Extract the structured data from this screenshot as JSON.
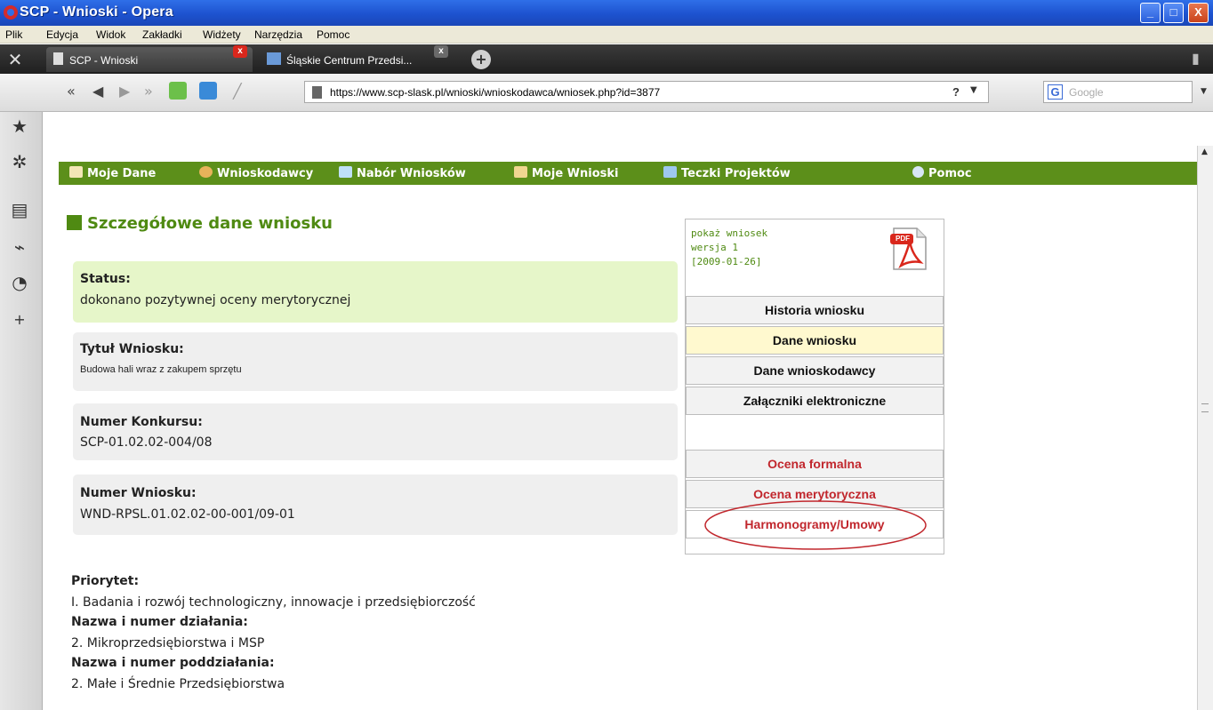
{
  "window": {
    "title": "SCP - Wnioski - Opera",
    "controls": [
      "_",
      "□",
      "X"
    ]
  },
  "menu": [
    "Plik",
    "Edycja",
    "Widok",
    "Zakładki",
    "Widżety",
    "Narzędzia",
    "Pomoc"
  ],
  "tabs": [
    {
      "label": "SCP - Wnioski",
      "active": true
    },
    {
      "label": "Śląskie Centrum Przedsi..."
    }
  ],
  "address": {
    "url": "https://www.scp-slask.pl/wnioski/wnioskodawca/wniosek.php?id=3877",
    "search_placeholder": "Google",
    "help": "?"
  },
  "nav": [
    "Moje Dane",
    "Wnioskodawcy",
    "Nabór Wniosków",
    "Moje Wnioski",
    "Teczki Projektów",
    "Pomoc"
  ],
  "section_title": "Szczegółowe dane wniosku",
  "status": {
    "label": "Status:",
    "value": "dokonano pozytywnej oceny merytorycznej"
  },
  "title_field": {
    "label": "Tytuł Wniosku:",
    "value": "Budowa hali wraz z zakupem sprzętu"
  },
  "contest": {
    "label": "Numer Konkursu:",
    "value": "SCP-01.02.02-004/08"
  },
  "application_no": {
    "label": "Numer Wniosku:",
    "value": "WND-RPSL.01.02.02-00-001/09-01"
  },
  "priority": {
    "label": "Priorytet:",
    "value": "I. Badania i rozwój technologiczny, innowacje i przedsiębiorczość"
  },
  "action": {
    "label": "Nazwa i numer działania:",
    "value": "2. Mikroprzedsiębiorstwa i MSP"
  },
  "subaction": {
    "label": "Nazwa i numer poddziałania:",
    "value": "2. Małe i Średnie Przedsiębiorstwa"
  },
  "pdf": {
    "line1": "pokaż wniosek",
    "line2": "wersja 1",
    "line3": "[2009-01-26]",
    "badge": "PDF"
  },
  "actions": [
    "Historia wniosku",
    "Dane wniosku",
    "Dane wnioskodawcy",
    "Załączniki elektroniczne",
    "Ocena formalna",
    "Ocena merytoryczna",
    "Harmonogramy/Umowy"
  ],
  "colors": {
    "nav_green": "#5c8f1a",
    "title_green": "#4f8a12",
    "status_bg": "#e6f6c9",
    "box_bg": "#efefef",
    "active_bg": "#fff9cf",
    "red_text": "#c1272d"
  }
}
